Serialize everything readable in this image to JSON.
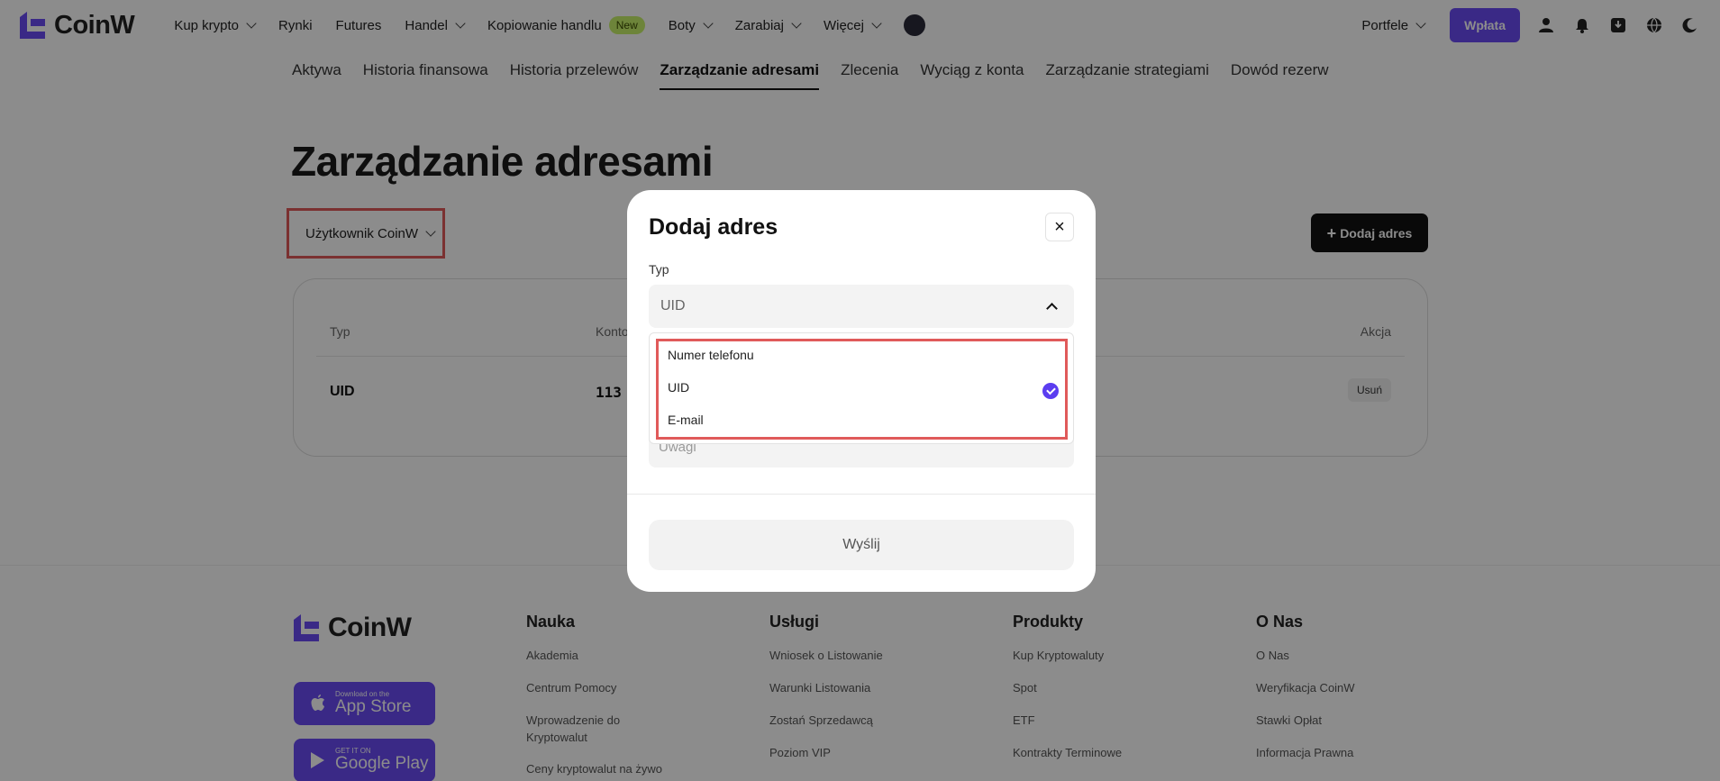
{
  "brand": {
    "name": "CoinW",
    "accent_color": "#6a4cf5"
  },
  "nav": {
    "items": [
      {
        "label": "Kup krypto",
        "dropdown": true
      },
      {
        "label": "Rynki",
        "dropdown": false
      },
      {
        "label": "Futures",
        "dropdown": false
      },
      {
        "label": "Handel",
        "dropdown": true
      },
      {
        "label": "Kopiowanie handlu",
        "dropdown": false,
        "badge": "New"
      },
      {
        "label": "Boty",
        "dropdown": true
      },
      {
        "label": "Zarabiaj",
        "dropdown": true
      },
      {
        "label": "Więcej",
        "dropdown": true
      }
    ],
    "wallets_label": "Portfele",
    "deposit_label": "Wpłata"
  },
  "subtabs": [
    "Aktywa",
    "Historia finansowa",
    "Historia przelewów",
    "Zarządzanie adresami",
    "Zlecenia",
    "Wyciąg z konta",
    "Zarządzanie strategiami",
    "Dowód rezerw"
  ],
  "page": {
    "title": "Zarządzanie adresami",
    "user_select": "Użytkownik CoinW",
    "add_button": "Dodaj adres"
  },
  "table": {
    "headers": {
      "type": "Typ",
      "account": "Konto",
      "action": "Akcja"
    },
    "rows": [
      {
        "type": "UID",
        "account": "113",
        "action": "Usuń"
      }
    ]
  },
  "modal": {
    "title": "Dodaj adres",
    "close": "×",
    "type_label": "Typ",
    "type_value": "UID",
    "options": [
      "Numer telefonu",
      "UID",
      "E-mail"
    ],
    "selected_option": "UID",
    "remarks_placeholder": "Uwagi",
    "submit": "Wyślij"
  },
  "footer": {
    "brand": "CoinW",
    "app_store": {
      "small": "Download on the",
      "big": "App Store"
    },
    "google_play": {
      "small": "GET IT ON",
      "big": "Google Play"
    },
    "columns": [
      {
        "title": "Nauka",
        "links": [
          "Akademia",
          "Centrum Pomocy",
          "Wprowadzenie do Kryptowalut",
          "Ceny kryptowalut na żywo"
        ]
      },
      {
        "title": "Usługi",
        "links": [
          "Wniosek o Listowanie",
          "Warunki Listowania",
          "Zostań Sprzedawcą",
          "Poziom VIP"
        ]
      },
      {
        "title": "Produkty",
        "links": [
          "Kup Kryptowaluty",
          "Spot",
          "ETF",
          "Kontrakty Terminowe"
        ]
      },
      {
        "title": "O Nas",
        "links": [
          "O Nas",
          "Weryfikacja CoinW",
          "Stawki Opłat",
          "Informacja Prawna"
        ]
      }
    ]
  }
}
